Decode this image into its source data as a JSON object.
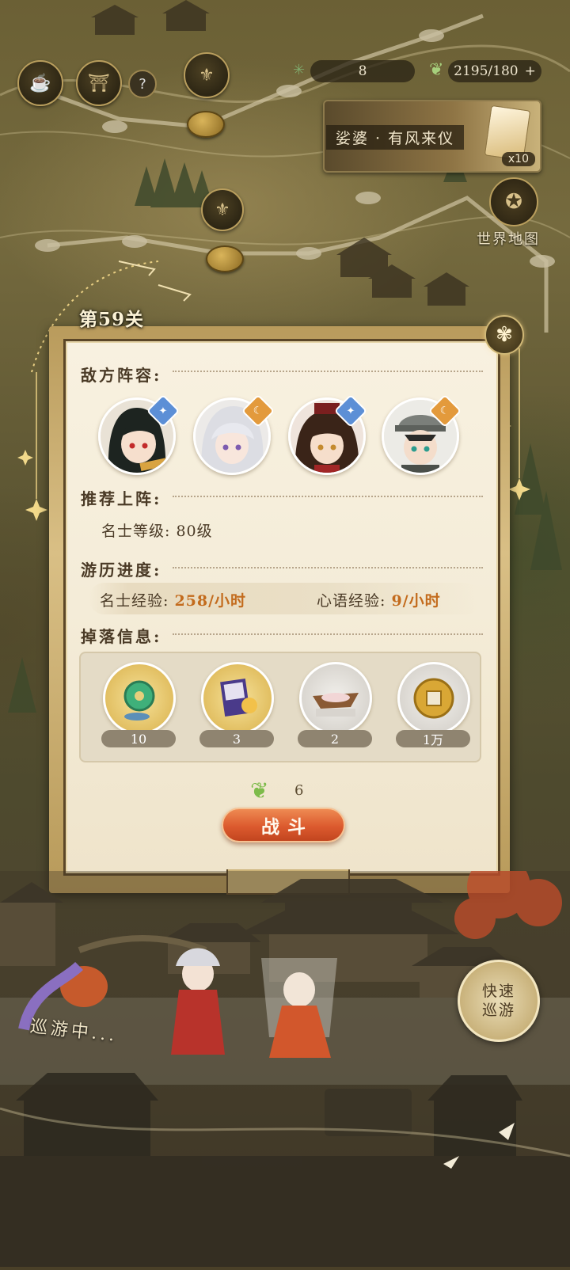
{
  "hud": {
    "stamina_value": "8",
    "leaf_resource": "2195/180",
    "plus": "+",
    "help": "?"
  },
  "event": {
    "title": "娑婆 · 有风来仪",
    "multiplier": "x10"
  },
  "world_map": {
    "label": "世界地图"
  },
  "stage": {
    "label": "第59关"
  },
  "dialog": {
    "enemy_title": "敌方阵容:",
    "recommend_title": "推荐上阵:",
    "recommend_text": "名士等级: 80级",
    "progress_title": "游历进度:",
    "exp_left_label": "名士经验:",
    "exp_left_value": "258/小时",
    "exp_right_label": "心语经验:",
    "exp_right_value": "9/小时",
    "drops_title": "掉落信息:",
    "drops": [
      {
        "item": "jade-pendant",
        "count": "10"
      },
      {
        "item": "book-scroll",
        "count": "3"
      },
      {
        "item": "flower-dish",
        "count": "2"
      },
      {
        "item": "copper-coin",
        "count": "1万"
      }
    ],
    "cost_value": "6",
    "fight_label": "战斗"
  },
  "enemies": [
    {
      "name": "black-hair-hero",
      "badge": "blue-diamond",
      "badge_color": "#5c8fd6"
    },
    {
      "name": "white-hair-hero",
      "badge": "orange-moon",
      "badge_color": "#e39a3c"
    },
    {
      "name": "crowned-hero",
      "badge": "blue-diamond",
      "badge_color": "#5c8fd6"
    },
    {
      "name": "capped-hero",
      "badge": "orange-moon",
      "badge_color": "#e39a3c"
    }
  ],
  "bottom": {
    "patrol_status": "巡游中...",
    "quick_patrol_line1": "快速",
    "quick_patrol_line2": "巡游"
  }
}
